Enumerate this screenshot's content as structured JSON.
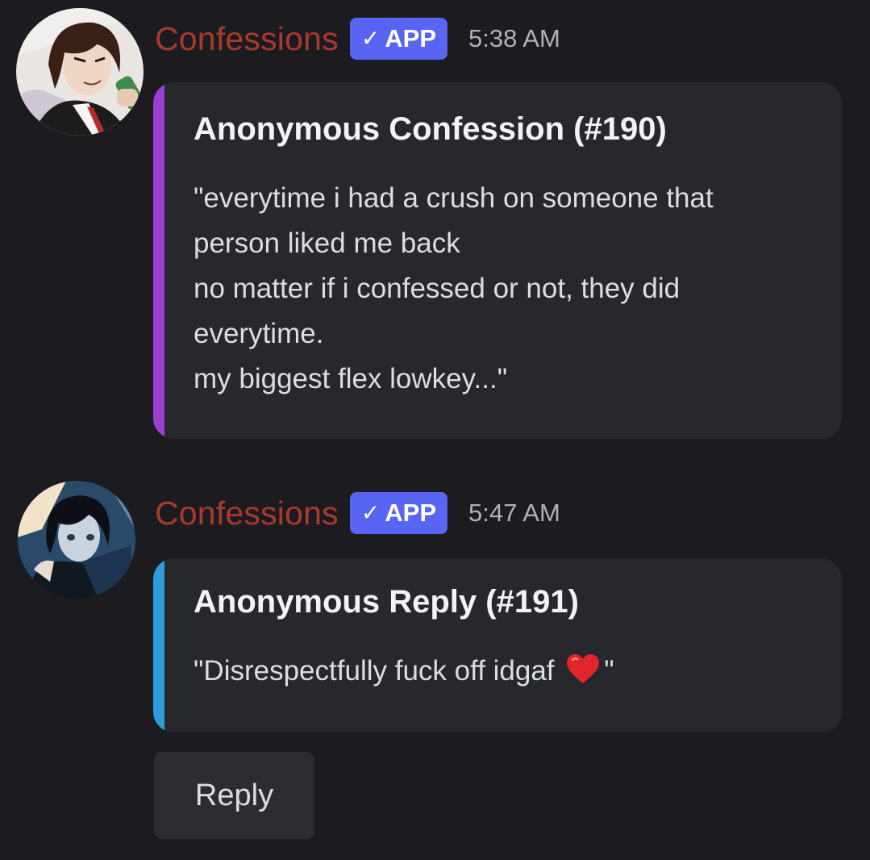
{
  "messages": [
    {
      "username": "Confessions",
      "badge": "APP",
      "timestamp": "5:38 AM",
      "embed": {
        "accent_color": "#9a3fd1",
        "title": "Anonymous Confession (#190)",
        "lines": [
          "\"everytime i had a crush on someone that",
          "person liked me back",
          "no matter if i confessed or not, they did",
          "everytime.",
          "my biggest flex lowkey...\""
        ]
      }
    },
    {
      "username": "Confessions",
      "badge": "APP",
      "timestamp": "5:47 AM",
      "embed": {
        "accent_color": "#2d9bdc",
        "title": "Anonymous Reply (#191)",
        "text_before_emoji": "\"Disrespectfully fuck off idgaf",
        "emoji": "heart-icon",
        "text_after_emoji": "\""
      }
    }
  ],
  "reply_button": {
    "label": "Reply"
  },
  "colors": {
    "background": "#1c1c20",
    "username": "#a83a2c",
    "badge": "#5865f2",
    "embed_bg": "#27282e"
  }
}
